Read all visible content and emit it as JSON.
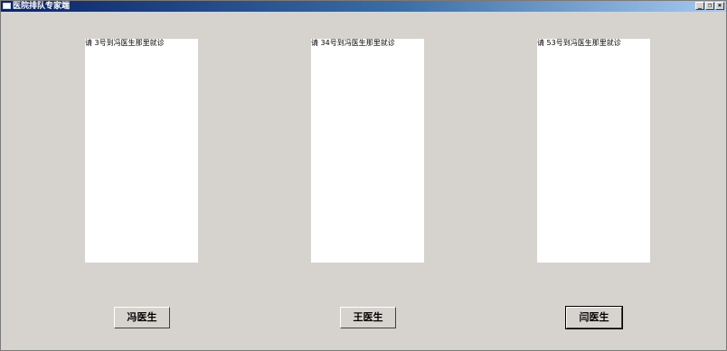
{
  "window": {
    "title": "医院排队专家端",
    "controls": {
      "minimize": "_",
      "restore": "❐",
      "close": "×"
    }
  },
  "panels": [
    {
      "text": "请 3号到冯医生那里就诊"
    },
    {
      "text": "请 34号到冯医生那里就诊"
    },
    {
      "text": "请 53号到冯医生那里就诊"
    }
  ],
  "buttons": [
    {
      "label": "冯医生"
    },
    {
      "label": "王医生"
    },
    {
      "label": "闫医生"
    }
  ]
}
